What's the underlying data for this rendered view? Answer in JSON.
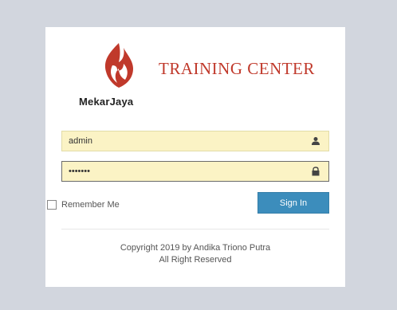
{
  "brand": {
    "name": "MekarJaya",
    "title": "TRAINING CENTER",
    "logo_icon": "flame-logo-icon",
    "title_color": "#c0392b"
  },
  "login": {
    "username_value": "admin",
    "username_icon": "user-icon",
    "password_value": "1234567",
    "password_icon": "lock-icon",
    "remember_label": "Remember Me",
    "signin_label": "Sign In",
    "button_color": "#3c8dbc",
    "field_color": "#fbf3c5"
  },
  "footer": {
    "line1": "Copyright 2019 by Andika Triono Putra",
    "line2": "All Right Reserved"
  }
}
